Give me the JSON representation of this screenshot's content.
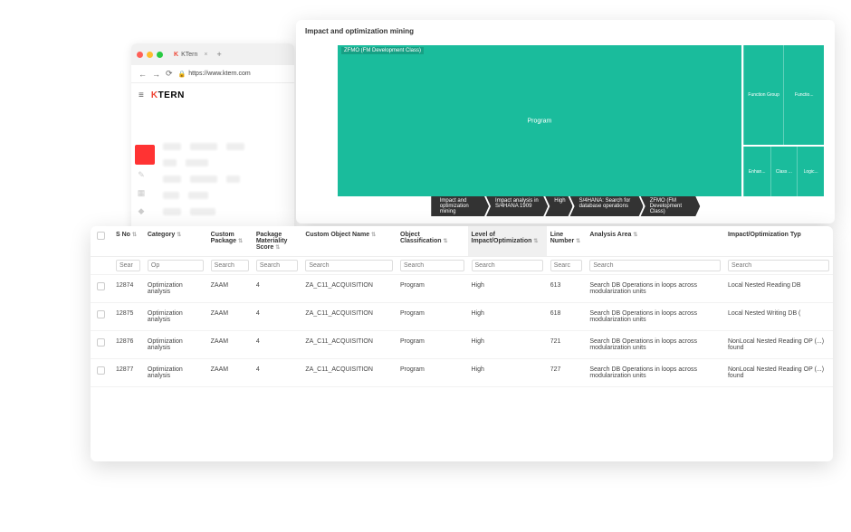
{
  "browser": {
    "tab_title": "KTern",
    "url": "https://www.ktern.com",
    "brand": "TERN"
  },
  "mining": {
    "title": "Impact and optimization mining",
    "treemap_label": "ZFMO (FM Development Class)",
    "treemap_center": "Program",
    "right_top": [
      "Function Group",
      "Functio..."
    ],
    "right_bottom": [
      "Enhan...",
      "Class ...",
      "Logic..."
    ],
    "crumbs": [
      "Impact and optimization mining",
      "Impact analysis in S/4HANA 1909",
      "High",
      "S/4HANA: Search for database operations",
      "ZFMO (FM Development Class)"
    ]
  },
  "table": {
    "headers": {
      "sno": "S No",
      "category": "Category",
      "package": "Custom Package",
      "materiality": "Package Materiality Score",
      "objname": "Custom Object Name",
      "classification": "Object Classification",
      "level": "Level of Impact/Optimization",
      "line": "Line Number",
      "area": "Analysis Area",
      "type": "Impact/Optimization Typ"
    },
    "filters": {
      "sno": "Sear",
      "category": "Op",
      "package": "Search",
      "materiality": "Search",
      "objname": "Search",
      "classification": "Search",
      "level": "Search",
      "line": "Searc",
      "area": "Search",
      "type": "Search"
    },
    "rows": [
      {
        "sno": "12874",
        "category": "Optimization analysis",
        "package": "ZAAM",
        "materiality": "4",
        "objname": "ZA_C11_ACQUISITION",
        "classification": "Program",
        "level": "High",
        "line": "613",
        "area": "Search DB Operations in loops across modularization units",
        "type": "Local Nested Reading DB"
      },
      {
        "sno": "12875",
        "category": "Optimization analysis",
        "package": "ZAAM",
        "materiality": "4",
        "objname": "ZA_C11_ACQUISITION",
        "classification": "Program",
        "level": "High",
        "line": "618",
        "area": "Search DB Operations in loops across modularization units",
        "type": "Local Nested Writing DB ("
      },
      {
        "sno": "12876",
        "category": "Optimization analysis",
        "package": "ZAAM",
        "materiality": "4",
        "objname": "ZA_C11_ACQUISITION",
        "classification": "Program",
        "level": "High",
        "line": "721",
        "area": "Search DB Operations in loops across modularization units",
        "type": "NonLocal Nested Reading OP (...) found"
      },
      {
        "sno": "12877",
        "category": "Optimization analysis",
        "package": "ZAAM",
        "materiality": "4",
        "objname": "ZA_C11_ACQUISITION",
        "classification": "Program",
        "level": "High",
        "line": "727",
        "area": "Search DB Operations in loops across modularization units",
        "type": "NonLocal Nested Reading OP (...) found"
      }
    ]
  }
}
